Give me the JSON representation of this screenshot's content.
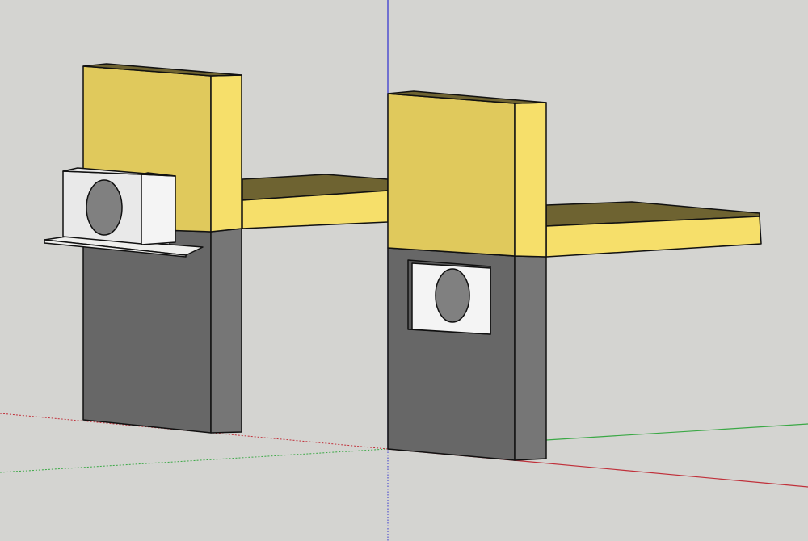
{
  "viewport": {
    "background_color": "#d4d4d1",
    "edge_color": "#111111"
  },
  "axes": {
    "red_axis_color": "#c0303a",
    "green_axis_color": "#3aa845",
    "blue_axis_color": "#3b3bd0"
  },
  "materials": {
    "yellow_front": "#e0c95c",
    "yellow_side": "#f6df6a",
    "yellow_top": "#6e6331",
    "dark_front": "#676767",
    "dark_side": "#767676",
    "unit_body": "#e9e9e9",
    "unit_side": "#f4f4f4",
    "fan_grey": "#808080",
    "shelf_white": "#efefed"
  },
  "objects": [
    {
      "name": "left-wall-block",
      "has_ac_unit": true,
      "ac_unit_mount": "bracket-shelf"
    },
    {
      "name": "right-wall-block",
      "has_ac_unit": true,
      "ac_unit_mount": "recessed-niche"
    }
  ]
}
